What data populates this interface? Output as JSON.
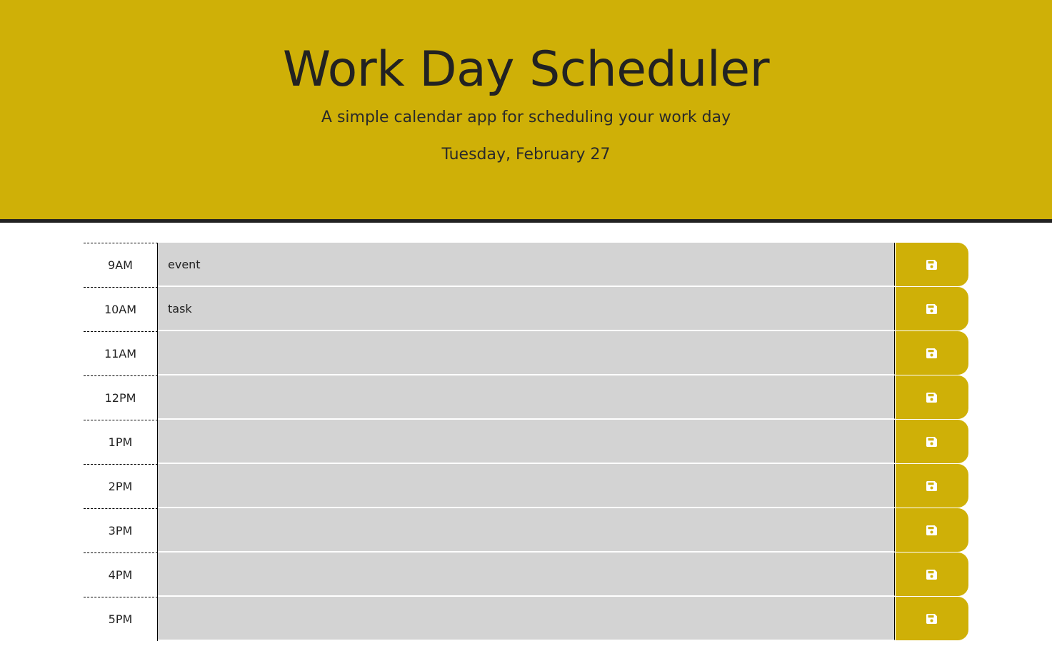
{
  "header": {
    "title": "Work Day Scheduler",
    "subtitle": "A simple calendar app for scheduling your work day",
    "current_day": "Tuesday, February 27"
  },
  "colors": {
    "accent": "#cfb007",
    "past_block": "#d3d3d3",
    "header_border": "#222222"
  },
  "schedule": {
    "rows": [
      {
        "hour": "9AM",
        "text": "event",
        "save_icon": "floppy-disk-icon"
      },
      {
        "hour": "10AM",
        "text": "task",
        "save_icon": "floppy-disk-icon"
      },
      {
        "hour": "11AM",
        "text": "",
        "save_icon": "floppy-disk-icon"
      },
      {
        "hour": "12PM",
        "text": "",
        "save_icon": "floppy-disk-icon"
      },
      {
        "hour": "1PM",
        "text": "",
        "save_icon": "floppy-disk-icon"
      },
      {
        "hour": "2PM",
        "text": "",
        "save_icon": "floppy-disk-icon"
      },
      {
        "hour": "3PM",
        "text": "",
        "save_icon": "floppy-disk-icon"
      },
      {
        "hour": "4PM",
        "text": "",
        "save_icon": "floppy-disk-icon"
      },
      {
        "hour": "5PM",
        "text": "",
        "save_icon": "floppy-disk-icon"
      }
    ]
  }
}
